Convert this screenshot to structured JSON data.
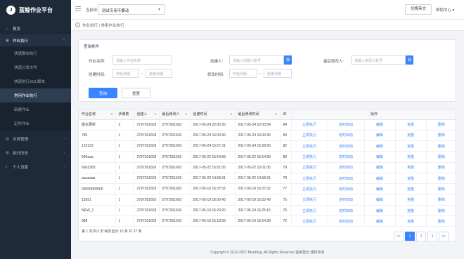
{
  "app": {
    "title": "蓝鲸作业平台",
    "logo_letter": "J"
  },
  "header": {
    "biz_label": "当前业务:",
    "biz_value": "测试专用不要动",
    "lang_button": "切换英文",
    "help_menu": "帮助中心"
  },
  "sidebar": {
    "items": [
      {
        "label": "首页",
        "icon": "home-icon",
        "glyph": "⌂"
      },
      {
        "label": "作业执行",
        "icon": "doc-icon",
        "glyph": "▣",
        "arrow": "^"
      },
      {
        "label": "业务管理",
        "icon": "biz-icon",
        "glyph": "▤",
        "arrow": "›"
      },
      {
        "label": "执行历史",
        "icon": "history-icon",
        "glyph": "▥",
        "arrow": "›"
      },
      {
        "label": "个人设置",
        "icon": "user-icon",
        "glyph": "◐",
        "arrow": "›"
      }
    ],
    "subitems": [
      {
        "label": "快速脚本执行"
      },
      {
        "label": "快速分发文件"
      },
      {
        "label": "快速执行SQL脚本"
      },
      {
        "label": "常用作业执行"
      },
      {
        "label": "新建作业"
      },
      {
        "label": "定时作业"
      }
    ]
  },
  "breadcrumb": {
    "back": "<",
    "path": "作业执行 | 常用作业执行"
  },
  "query": {
    "title": "查询条件",
    "name_label": "作业名称:",
    "name_placeholder": "请输入作业名称",
    "creator_label": "创建人:",
    "creator_placeholder": "请输入创建人账号",
    "creator_btn": "我",
    "modifier_label": "最后修改人:",
    "modifier_placeholder": "请输入修改人账号",
    "modifier_btn": "我",
    "created_label": "创建时间:",
    "start_placeholder": "开始日期",
    "end_placeholder": "结束日期",
    "modified_label": "修改时间:",
    "dash": "-",
    "query_btn": "查询",
    "reset_btn": "重置"
  },
  "table": {
    "headers": [
      "作业名称",
      "步骤数",
      "创建人",
      "最后修改人",
      "创建时间",
      "最后修改时间",
      "ID",
      "操作"
    ],
    "actions": [
      "立即执行",
      "定时启动",
      "编辑",
      "克隆",
      "删除"
    ],
    "rows": [
      [
        "版本更新",
        "3",
        "2797261603",
        "2797261603",
        "2017-05-24 22:00:30",
        "2017-05-24 22:00:54",
        "84"
      ],
      [
        "789",
        "1",
        "2797261603",
        "2797261603",
        "2017-05-24 16:00:36",
        "2017-05-24 16:00:36",
        "83"
      ],
      [
        "123123",
        "1",
        "2797261603",
        "2797261603",
        "2017-05-24 15:57:31",
        "2017-05-24 15:58:59",
        "82"
      ],
      [
        "999aaa",
        "1",
        "2797261603",
        "2797261603",
        "2017-05-22 15:54:58",
        "2017-05-22 15:54:58",
        "80"
      ],
      [
        "6662363",
        "1",
        "2797261603",
        "2797261603",
        "2017-05-22 15:01:05",
        "2017-05-22 15:01:05",
        "79"
      ],
      [
        "aaaaaaa",
        "1",
        "2797261603",
        "2797261603",
        "2017-05-22 14:58:31",
        "2017-05-22 14:58:31",
        "78"
      ],
      [
        "ppppppppppp",
        "1",
        "2797261603",
        "2797261603",
        "2017-05-19 16:37:02",
        "2017-05-19 16:37:02",
        "77"
      ],
      [
        "15551",
        "1",
        "2797261603",
        "2797261603",
        "2017-05-19 16:09:43",
        "2017-05-19 16:32:49",
        "75"
      ],
      [
        "NEW_1",
        "1",
        "2797261603",
        "2797261603",
        "2017-05-19 16:24:20",
        "2017-05-19 16:25:16",
        "76"
      ],
      [
        "988",
        "1",
        "2797261603",
        "2797261603",
        "2017-05-19 15:18:59",
        "2017-05-19 15:54:38",
        "72"
      ]
    ],
    "page_info": "第 1 页/共3 页  每页显示 10 条  共 27 条",
    "pager": [
      "<<",
      "1",
      "2",
      "3",
      ">>"
    ]
  },
  "footer": {
    "text": "Copyright © 2012-2017 BlueKing. All Rights Reserved 蓝鲸智云 版权所有"
  },
  "colors": {
    "primary": "#3a84ff",
    "sidebar": "#1e2a3a"
  }
}
